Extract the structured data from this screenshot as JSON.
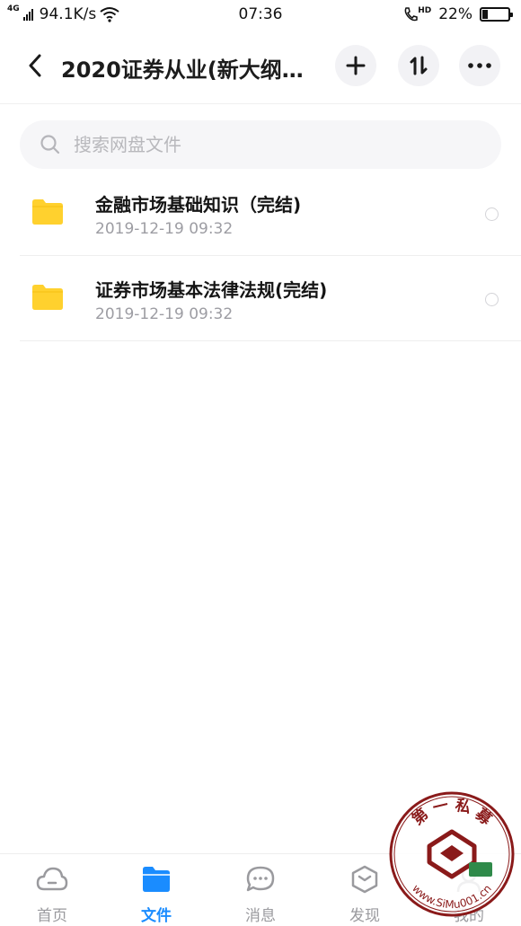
{
  "status_bar": {
    "network_type": "4G",
    "speed": "94.1K/s",
    "time": "07:36",
    "call_hd": "HD",
    "battery_percent": "22%",
    "battery_level": 0.22
  },
  "header": {
    "title": "2020证券从业(新大纲…",
    "back_icon": "back-arrow-icon",
    "add_icon": "plus-icon",
    "sort_icon": "sort-icon",
    "more_icon": "more-dots-icon"
  },
  "search": {
    "placeholder": "搜索网盘文件"
  },
  "files": [
    {
      "name": "金融市场基础知识（完结)",
      "date": "2019-12-19  09:32",
      "icon": "folder-icon"
    },
    {
      "name": "证券市场基本法律法规(完结)",
      "date": "2019-12-19  09:32",
      "icon": "folder-icon"
    }
  ],
  "bottom_nav": {
    "items": [
      {
        "label": "首页",
        "icon": "cloud-icon",
        "active": false
      },
      {
        "label": "文件",
        "icon": "folder-icon",
        "active": true
      },
      {
        "label": "消息",
        "icon": "chat-icon",
        "active": false
      },
      {
        "label": "发现",
        "icon": "discover-icon",
        "active": false
      },
      {
        "label": "我的",
        "icon": "profile-icon",
        "active": false
      }
    ]
  },
  "watermark": {
    "top_text": "第 一 私 募",
    "url_text": "www.SiMu001.cn"
  },
  "colors": {
    "accent": "#1a8cff",
    "folder": "#ffd12e",
    "muted_text": "#9d9da3"
  }
}
